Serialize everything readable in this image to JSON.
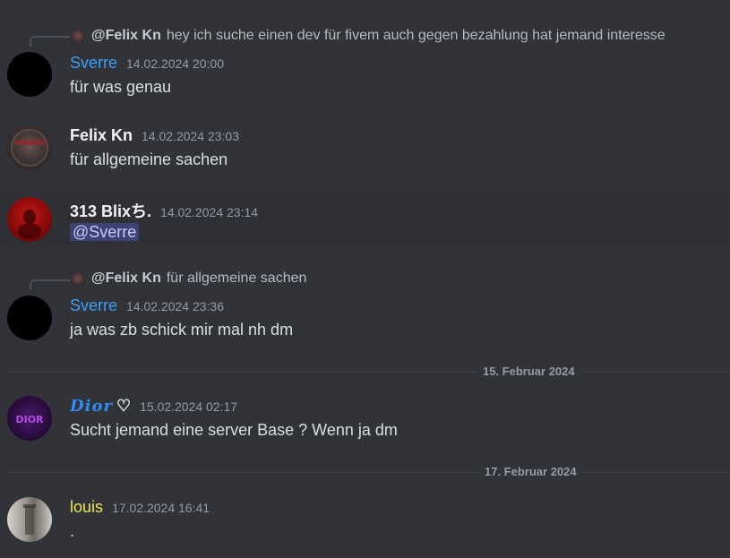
{
  "messages": [
    {
      "reply": {
        "name": "@Felix Kn",
        "text": "hey ich suche einen dev für fivem auch gegen bezahlung hat jemand interesse"
      },
      "author": "Sverre",
      "time": "14.02.2024 20:00",
      "text": "für was genau"
    },
    {
      "author": "Felix Kn",
      "time": "14.02.2024 23:03",
      "text": "für allgemeine sachen"
    },
    {
      "author": "313 Blixち.",
      "time": "14.02.2024 23:14",
      "mention": "@Sverre"
    },
    {
      "reply": {
        "name": "@Felix Kn",
        "text": "für allgemeine sachen"
      },
      "author": "Sverre",
      "time": "14.02.2024 23:36",
      "text": "ja was zb schick mir mal nh dm"
    },
    {
      "author": "Dior",
      "author_suffix": "♡",
      "time": "15.02.2024 02:17",
      "text": "Sucht jemand eine server Base ? Wenn ja dm"
    },
    {
      "author": "louis",
      "time": "17.02.2024 16:41",
      "text": "."
    }
  ],
  "dividers": [
    "15. Februar 2024",
    "17. Februar 2024"
  ],
  "colors": {
    "background": "#313338",
    "name_blue": "#3e9ef3",
    "name_yellow": "#f1e64a",
    "mention_bg": "#4a4f8a"
  },
  "avatar_mini_text": "DIOR"
}
